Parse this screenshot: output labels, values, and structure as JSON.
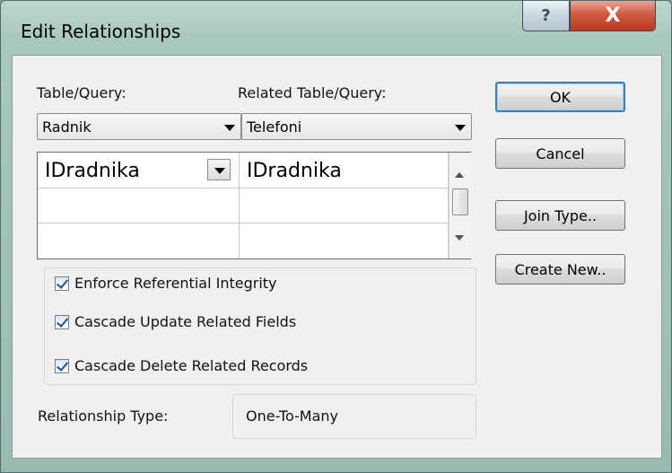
{
  "window": {
    "title": "Edit Relationships",
    "help_icon": "?",
    "close_icon": "X"
  },
  "table_query": {
    "label": "Table/Query:",
    "value": "Radnik"
  },
  "related_table_query": {
    "label": "Related Table/Query:",
    "value": "Telefoni"
  },
  "fields": {
    "rows": [
      {
        "left": "IDradnika",
        "right": "IDradnika"
      },
      {
        "left": "",
        "right": ""
      },
      {
        "left": "",
        "right": ""
      }
    ]
  },
  "options": {
    "enforce": {
      "label": "Enforce Referential Integrity",
      "checked": true
    },
    "cascade_update": {
      "label": "Cascade Update Related Fields",
      "checked": true
    },
    "cascade_delete": {
      "label": "Cascade Delete Related Records",
      "checked": true
    }
  },
  "relationship": {
    "label": "Relationship Type:",
    "value": "One-To-Many"
  },
  "buttons": {
    "ok": "OK",
    "cancel": "Cancel",
    "join_type": "Join Type..",
    "create_new": "Create New.."
  }
}
